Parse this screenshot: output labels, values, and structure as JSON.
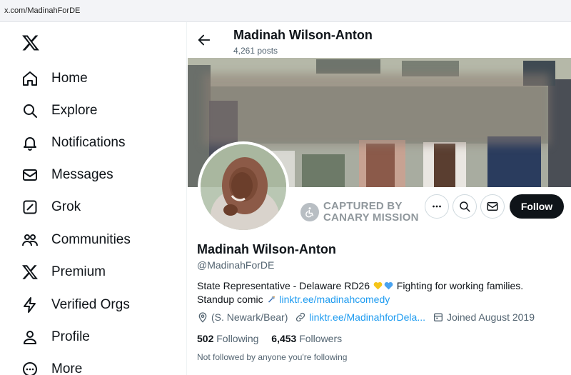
{
  "browser": {
    "url": "x.com/MadinahForDE"
  },
  "sidebar": {
    "items": [
      {
        "label": "Home",
        "icon": "home-icon"
      },
      {
        "label": "Explore",
        "icon": "search-icon"
      },
      {
        "label": "Notifications",
        "icon": "bell-icon"
      },
      {
        "label": "Messages",
        "icon": "mail-icon"
      },
      {
        "label": "Grok",
        "icon": "grok-icon"
      },
      {
        "label": "Communities",
        "icon": "people-icon"
      },
      {
        "label": "Premium",
        "icon": "x-logo-icon"
      },
      {
        "label": "Verified Orgs",
        "icon": "lightning-icon"
      },
      {
        "label": "Profile",
        "icon": "person-icon"
      },
      {
        "label": "More",
        "icon": "more-circle-icon"
      }
    ]
  },
  "header": {
    "name": "Madinah Wilson-Anton",
    "posts": "4,261 posts"
  },
  "watermark": {
    "line1": "CAPTURED BY",
    "line2": "CANARY MISSION"
  },
  "actions": {
    "follow_label": "Follow"
  },
  "profile": {
    "name": "Madinah Wilson-Anton",
    "handle": "@MadinahForDE",
    "bio_text": "State Representative - Delaware RD26",
    "bio_text2": "Fighting for working families.",
    "bio_line2": "Standup comic",
    "bio_link": "linktr.ee/madinahcomedy",
    "location": "(S. Newark/Bear)",
    "website": "linktr.ee/MadinahforDela...",
    "joined": "Joined August 2019",
    "following_count": "502",
    "following_label": "Following",
    "followers_count": "6,453",
    "followers_label": "Followers",
    "followed_note": "Not followed by anyone you're following"
  },
  "colors": {
    "accent": "#1d9bf0",
    "text": "#0f1419",
    "muted": "#536471",
    "heart_yellow": "#f5c518",
    "heart_blue": "#4aa3f0"
  }
}
